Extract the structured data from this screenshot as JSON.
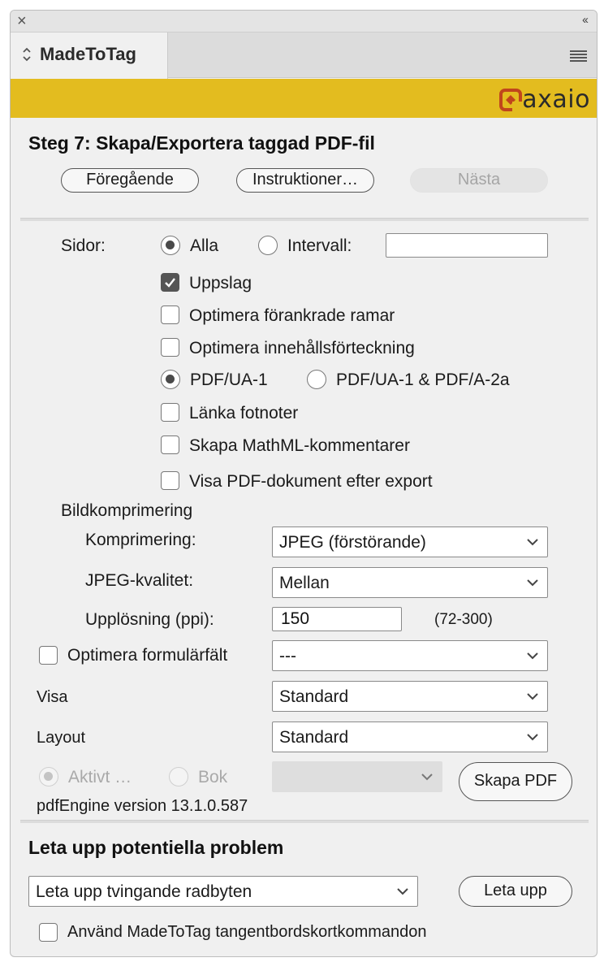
{
  "window": {
    "close_glyph": "×",
    "collapse_glyph": "‹‹",
    "tab_title": "MadeToTag"
  },
  "brand": {
    "logo_text": "axaio",
    "accent": "#e3bc1f",
    "logo_color": "#c0461c"
  },
  "step": {
    "title": "Steg 7: Skapa/Exportera taggad PDF-fil",
    "buttons": {
      "previous": "Föregående",
      "instructions": "Instruktioner…",
      "next": "Nästa"
    }
  },
  "pages": {
    "label": "Sidor:",
    "all_label": "Alla",
    "all_selected": true,
    "range_label": "Intervall:",
    "range_value": ""
  },
  "options": {
    "spreads": {
      "label": "Uppslag",
      "checked": true
    },
    "optimize_anchored": {
      "label": "Optimera förankrade ramar",
      "checked": false
    },
    "optimize_toc": {
      "label": "Optimera innehållsförteckning",
      "checked": false
    },
    "pdfua1": {
      "label": "PDF/UA-1",
      "selected": true
    },
    "pdfua1_pdfa2a": {
      "label": "PDF/UA-1 & PDF/A-2a",
      "selected": false
    },
    "link_footnotes": {
      "label": "Länka fotnoter",
      "checked": false
    },
    "mathml": {
      "label": "Skapa MathML-kommentarer",
      "checked": false
    },
    "show_pdf": {
      "label": "Visa PDF-dokument efter export",
      "checked": false
    }
  },
  "image_compression": {
    "heading": "Bildkomprimering",
    "compression_label": "Komprimering:",
    "compression_value": "JPEG (förstörande)",
    "quality_label": "JPEG-kvalitet:",
    "quality_value": "Mellan",
    "resolution_label": "Upplösning (ppi):",
    "resolution_value": "150",
    "resolution_range": "(72-300)"
  },
  "form_fields": {
    "label": "Optimera formulärfält",
    "checked": false,
    "value": "---"
  },
  "view": {
    "label": "Visa",
    "value": "Standard"
  },
  "layout": {
    "label": "Layout",
    "value": "Standard"
  },
  "export": {
    "active_label": "Aktivt …",
    "active_selected": true,
    "book_label": "Bok",
    "book_value": "",
    "create_pdf": "Skapa PDF",
    "engine_version": "pdfEngine version 13.1.0.587"
  },
  "problems": {
    "heading": "Leta upp potentiella problem",
    "search_value": "Leta upp tvingande radbyten",
    "search_button": "Leta upp",
    "shortcuts_label": "Använd MadeToTag tangentbordskortkommandon",
    "shortcuts_checked": false
  }
}
